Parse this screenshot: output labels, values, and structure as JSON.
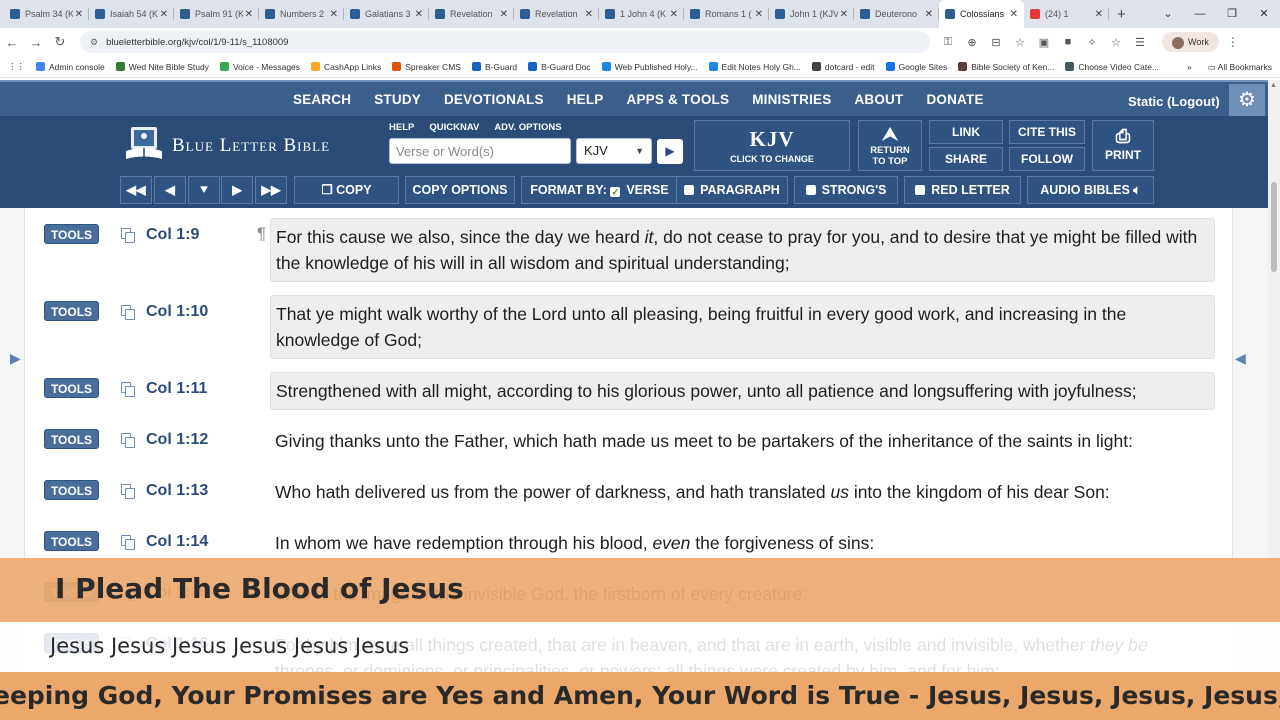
{
  "browser": {
    "tabs": [
      {
        "label": "Psalm 34 (K",
        "active": false,
        "icon": "blb-favicon"
      },
      {
        "label": "Isaiah 54 (K",
        "active": false,
        "icon": "blb-favicon"
      },
      {
        "label": "Psalm 91 (K",
        "active": false,
        "icon": "blb-favicon"
      },
      {
        "label": "Numbers 2",
        "active": false,
        "icon": "blb-favicon"
      },
      {
        "label": "Galatians 3",
        "active": false,
        "icon": "blb-favicon"
      },
      {
        "label": "Revelation",
        "active": false,
        "icon": "blb-favicon"
      },
      {
        "label": "Revelation",
        "active": false,
        "icon": "blb-favicon"
      },
      {
        "label": "1 John 4 (K",
        "active": false,
        "icon": "blb-favicon"
      },
      {
        "label": "Romans 1 (",
        "active": false,
        "icon": "blb-favicon"
      },
      {
        "label": "John 1 (KJV",
        "active": false,
        "icon": "blb-favicon"
      },
      {
        "label": "Deuterono",
        "active": false,
        "icon": "blb-favicon"
      },
      {
        "label": "Colossians",
        "active": true,
        "icon": "blb-favicon"
      },
      {
        "label": "(24) 1",
        "active": false,
        "icon": "youtube-favicon"
      }
    ],
    "url": "blueletterbible.org/kjv/col/1/9-11/s_1108009",
    "profile": "Work",
    "bookmarks": [
      "Admin console",
      "Wed Nite Bible Study",
      "Voice - Messages",
      "CashApp Links",
      "Spreaker CMS",
      "B-Guard",
      "B-Guard Doc",
      "Web Published Holy...",
      "Edit Notes Holy Gh...",
      "dotcard - edit",
      "Google Sites",
      "Bible Society of Ken...",
      "Choose Video Cate..."
    ],
    "all_bookmarks": "All Bookmarks"
  },
  "site": {
    "topnav": [
      "SEARCH",
      "STUDY",
      "DEVOTIONALS",
      "HELP",
      "APPS & TOOLS",
      "MINISTRIES",
      "ABOUT",
      "DONATE"
    ],
    "login": "Static (Logout)",
    "logo_text": "Blue Letter Bible",
    "mini_links": [
      "HELP",
      "QUICKNAV",
      "ADV. OPTIONS"
    ],
    "search_placeholder": "Verse or Word(s)",
    "version": "KJV",
    "kjv_big": "KJV",
    "kjv_small": "CLICK TO CHANGE",
    "return_to_top": [
      "RETURN",
      "TO TOP"
    ],
    "link": "LINK",
    "cite_this": "CITE THIS",
    "share": "SHARE",
    "follow": "FOLLOW",
    "print": "PRINT",
    "toolbar": {
      "copy": "COPY",
      "copy_options": "COPY OPTIONS",
      "format_by": "FORMAT BY:",
      "verse": "VERSE",
      "paragraph": "PARAGRAPH",
      "strongs": "STRONG'S",
      "red_letter": "RED LETTER",
      "audio_bibles": "AUDIO BIBLES"
    }
  },
  "tools_label": "TOOLS",
  "verses": [
    {
      "ref": "Col 1:9",
      "highlight": true,
      "para_mark": "¶",
      "text_html": "For this cause we also, since the day we heard <i>it</i>, do not cease to pray for you, and to desire that ye might be filled with the knowledge of his will in all wisdom and spiritual understanding;"
    },
    {
      "ref": "Col 1:10",
      "highlight": true,
      "para_mark": "",
      "text_html": "That ye might walk worthy of the Lord unto all pleasing, being fruitful in every good work, and increasing in the knowledge of God;"
    },
    {
      "ref": "Col 1:11",
      "highlight": true,
      "para_mark": "",
      "text_html": "Strengthened with all might, according to his glorious power, unto all patience and longsuffering with joyfulness;"
    },
    {
      "ref": "Col 1:12",
      "highlight": false,
      "para_mark": "",
      "text_html": "Giving thanks unto the Father, which hath made us meet to be partakers of the inheritance of the saints in light:"
    },
    {
      "ref": "Col 1:13",
      "highlight": false,
      "para_mark": "",
      "text_html": "Who hath delivered us from the power of darkness, and hath translated <i>us</i> into the kingdom of his dear Son:"
    },
    {
      "ref": "Col 1:14",
      "highlight": false,
      "para_mark": "",
      "text_html": "In whom we have redemption through his blood, <i>even</i> the forgiveness of sins:"
    },
    {
      "ref": "Col 1:15",
      "highlight": false,
      "para_mark": "",
      "text_html": "Who is the image of the invisible God, the firstborn of every creature:"
    },
    {
      "ref": "Col 1:16",
      "highlight": false,
      "para_mark": "",
      "text_html": "For by him were all things created, that are in heaven, and that are in earth, visible and invisible, whether <i>they be</i> thrones, or dominions, or principalities, or powers: all things were created by him, and for him:"
    }
  ],
  "overlay": {
    "title": "I Plead The Blood of Jesus",
    "subtitle": "Jesus Jesus Jesus Jesus Jesus Jesus",
    "ticker": "eeping God, Your Promises are Yes and Amen, Your Word is True - Jesus, Jesus, Jesus, Jesus, Jesus, J"
  }
}
